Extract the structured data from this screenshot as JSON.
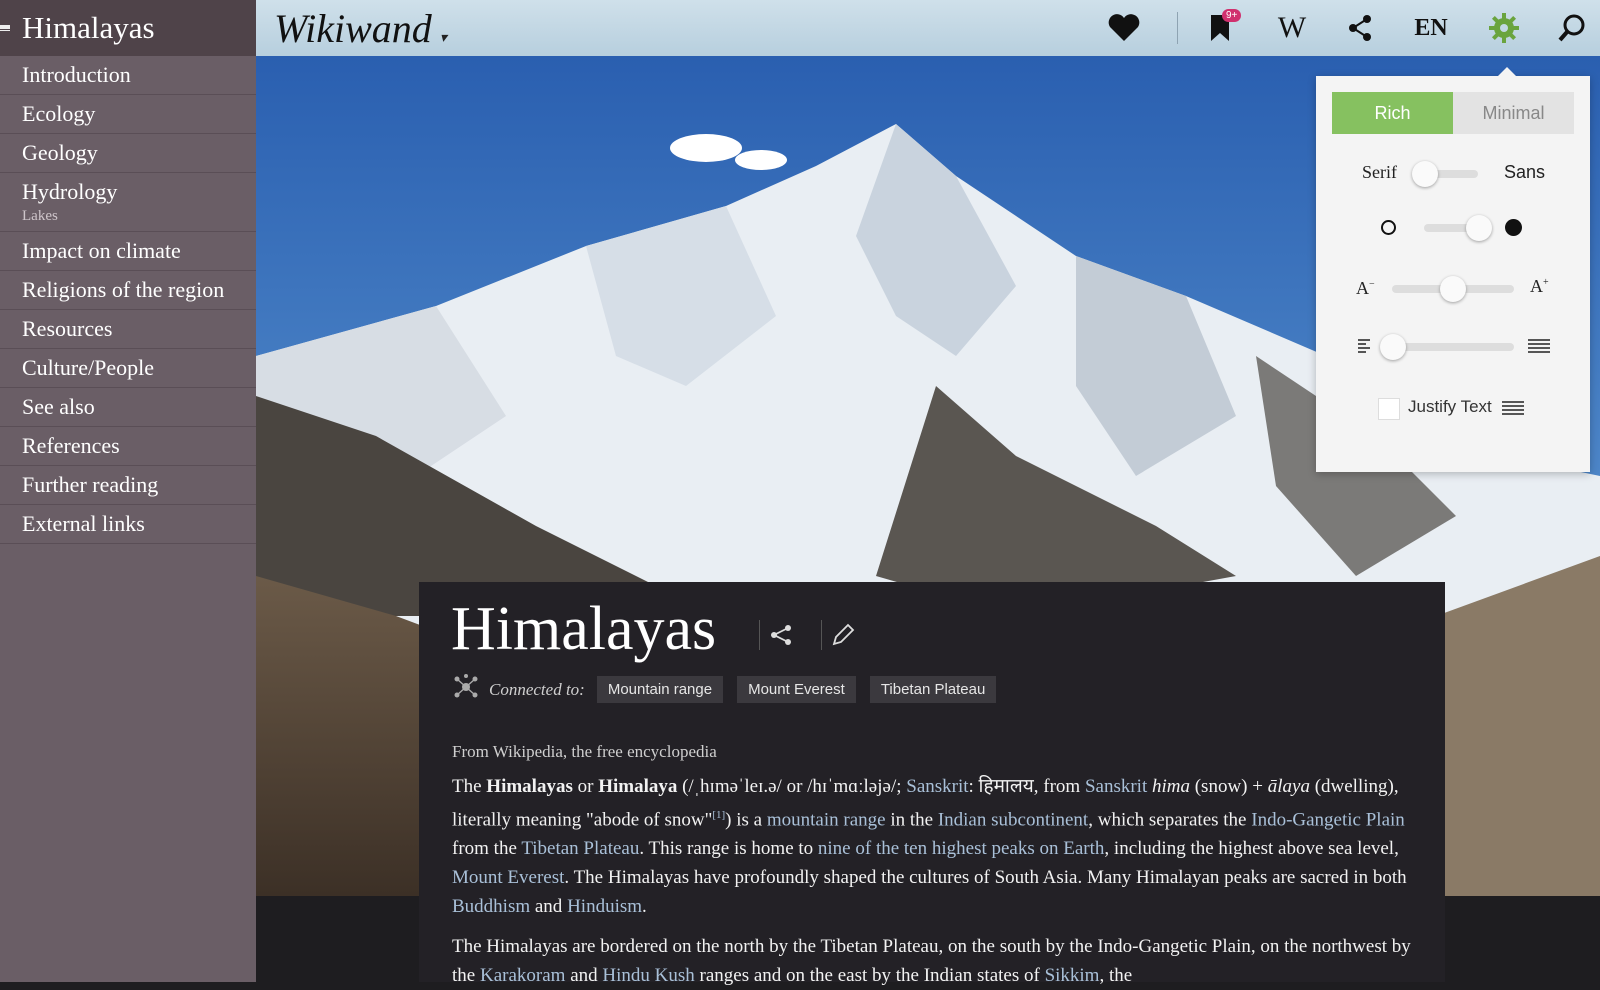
{
  "sidebar": {
    "title": "Himalayas",
    "items": [
      {
        "label": "Introduction"
      },
      {
        "label": "Ecology"
      },
      {
        "label": "Geology"
      },
      {
        "label": "Hydrology",
        "sub": "Lakes"
      },
      {
        "label": "Impact on climate"
      },
      {
        "label": "Religions of the region"
      },
      {
        "label": "Resources"
      },
      {
        "label": "Culture/People"
      },
      {
        "label": "See also"
      },
      {
        "label": "References"
      },
      {
        "label": "Further reading"
      },
      {
        "label": "External links"
      }
    ]
  },
  "topbar": {
    "logo": "Wikiwand",
    "bookmark_badge": "9+",
    "wikipedia_label": "W",
    "language": "EN"
  },
  "settings": {
    "rich_label": "Rich",
    "minimal_label": "Minimal",
    "serif_label": "Serif",
    "sans_label": "Sans",
    "font_size_small": "A",
    "font_size_large": "A",
    "justify_label": "Justify Text",
    "font_slider": 0.0,
    "theme_slider": 1.0,
    "size_slider": 0.5,
    "width_slider": 0.0,
    "justify_checked": false
  },
  "article": {
    "title": "Himalayas",
    "connected_label": "Connected to:",
    "tags": [
      "Mountain range",
      "Mount Everest",
      "Tibetan Plateau"
    ],
    "from": "From Wikipedia, the free encyclopedia",
    "p1": {
      "t1": "The ",
      "b1": "Himalayas",
      "t2": " or ",
      "b2": "Himalaya",
      "t3": " (/ˌhɪməˈleɪ.ə/ or /hɪˈmɑːləjə/; ",
      "l1": "Sanskrit",
      "t4": ": हिमालय, from ",
      "l2": "Sanskrit",
      "t5": " ",
      "i1": "hima",
      "t6": " (snow) + ",
      "i2": "ālaya",
      "t7": " (dwelling), literally meaning \"abode of snow\"",
      "sup": "[1]",
      "t8": ") is a ",
      "l3": "mountain range",
      "t9": " in the ",
      "l4": "Indian subcontinent",
      "t10": ", which separates the ",
      "l5": "Indo-Gangetic Plain",
      "t11": " from the ",
      "l6": "Tibetan Plateau",
      "t12": ". This range is home to ",
      "l7": "nine of the ten highest peaks on Earth",
      "t13": ", including the highest above sea level, ",
      "l8": "Mount Everest",
      "t14": ". The Himalayas have profoundly shaped the cultures of South Asia. Many Himalayan peaks are sacred in both ",
      "l9": "Buddhism",
      "t15": " and ",
      "l10": "Hinduism",
      "t16": "."
    },
    "p2": {
      "t1": "The Himalayas are bordered on the north by the Tibetan Plateau, on the south by the Indo-Gangetic Plain, on the northwest by the ",
      "l1": "Karakoram",
      "t2": " and ",
      "l2": "Hindu Kush",
      "t3": " ranges and on the east by the Indian states of ",
      "l3": "Sikkim",
      "t4": ", the"
    }
  },
  "colors": {
    "sidebar_bg": "#6a5e66",
    "accent_green": "#86c160",
    "badge_pink": "#d0306e",
    "link": "#a9c0d8"
  }
}
